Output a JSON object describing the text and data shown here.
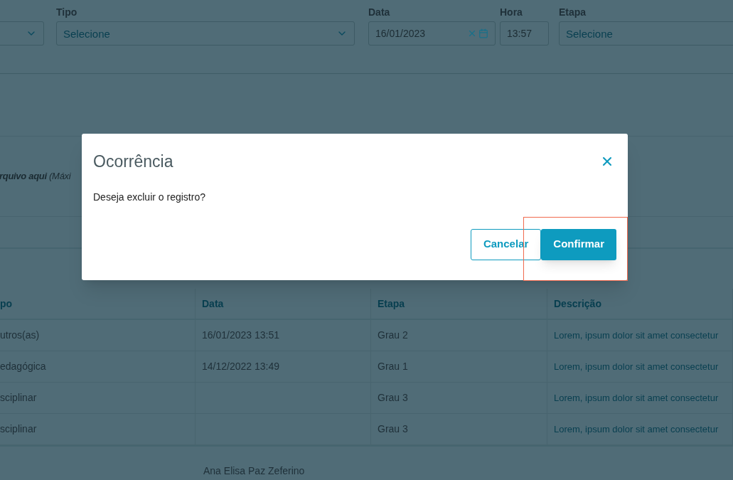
{
  "filters": [
    {
      "kind": "select"
    },
    {
      "kind": "select",
      "label": "Tipo",
      "placeholder": "Selecione"
    },
    {
      "kind": "date",
      "label": "Data",
      "value": "16/01/2023"
    },
    {
      "kind": "text",
      "label": "Hora",
      "value": "13:57"
    },
    {
      "kind": "select",
      "label": "Etapa",
      "placeholder": "Selecione"
    }
  ],
  "upload_hint": "**rquivo aqui** (Máxi",
  "table": {
    "columns": [
      "po",
      "Data",
      "Etapa",
      "Descrição"
    ],
    "rows": [
      [
        "utros(as)",
        "16/01/2023 13:51",
        "Grau 2",
        "Lorem, ipsum dolor sit amet consectetur"
      ],
      [
        "edagógica",
        "14/12/2022 13:49",
        "Grau 1",
        "Lorem, ipsum dolor sit amet consectetur"
      ],
      [
        "sciplinar",
        null,
        "Grau 3",
        "Lorem, ipsum dolor sit amet consectetur"
      ],
      [
        "sciplinar",
        null,
        "Grau 3",
        "Lorem, ipsum dolor sit amet consectetur"
      ]
    ]
  },
  "footer_name": "Ana Elisa Paz Zeferino",
  "dialog": {
    "title": "Ocorrência",
    "message": "Deseja excluir o registro?",
    "buttons": [
      {
        "label": "Cancelar",
        "kind": "secondary"
      },
      {
        "label": "Confirmar",
        "kind": "primary"
      }
    ]
  },
  "annotation_frame": true
}
